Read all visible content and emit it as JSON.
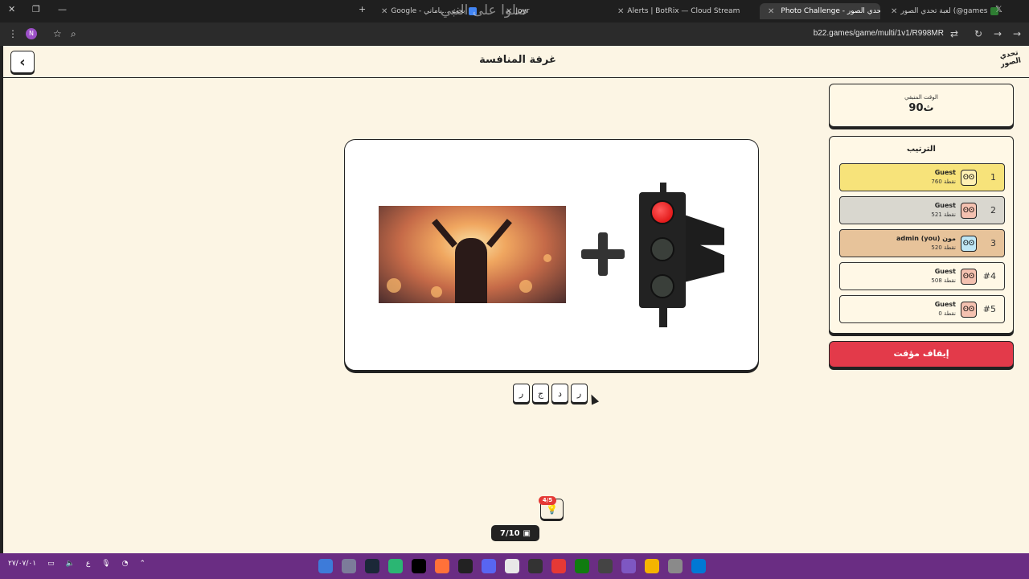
{
  "browser": {
    "tabs": [
      {
        "label": "Google - بحث ...ياماني",
        "favicon_color": "#4285f4"
      },
      {
        "label": "Joyr",
        "favicon_color": "#1a73e8"
      },
      {
        "label": "Alerts | BotRix — Cloud Stream",
        "favicon_color": "#e91e63"
      },
      {
        "label": "Photo Challenge - لعبة تحدي الصور",
        "favicon_color": "#ffffff"
      },
      {
        "label": "لعبة تحدي الصور (@games",
        "favicon_color": "#2e7d32"
      }
    ],
    "watermark": "صلوا على النبي",
    "url": "b22.games/game/multi/1v1/R998MR",
    "profile_initial": "N"
  },
  "header": {
    "title": "غرفة المنافسة",
    "logo_text": "تحدي الصور"
  },
  "puzzle": {
    "answer_letters": [
      "ر",
      "د",
      "ج",
      "ر"
    ]
  },
  "timer": {
    "label": "الوقت المتبقي",
    "value": "90ث"
  },
  "ranking": {
    "title": "الترتيب",
    "rows": [
      {
        "position": "1",
        "name": "Guest",
        "points": "760 نقطة",
        "bg": "#f7e37a",
        "avatar_bg": "#fff0b3"
      },
      {
        "position": "2",
        "name": "Guest",
        "points": "521 نقطة",
        "bg": "#d9d7cf",
        "avatar_bg": "#f4c1b0"
      },
      {
        "position": "3",
        "name": "admin (you) مون",
        "points": "520 نقطة",
        "bg": "#e7c39a",
        "avatar_bg": "#bfe7f5"
      },
      {
        "position": "#4",
        "name": "Guest",
        "points": "508 نقطة",
        "bg": "#fff8e6",
        "avatar_bg": "#f4c1b0"
      },
      {
        "position": "#5",
        "name": "Guest",
        "points": "0 نقطة",
        "bg": "#fff8e6",
        "avatar_bg": "#f4c1b0"
      }
    ]
  },
  "pause_button": "إيقاف مؤقت",
  "hints": {
    "badge": "4/5",
    "icon": "lightbulb-icon"
  },
  "round": {
    "label": "7/10",
    "icon": "image-icon"
  },
  "taskbar": {
    "date": "٢٧/٠٧/٠١",
    "lang": "ع"
  }
}
